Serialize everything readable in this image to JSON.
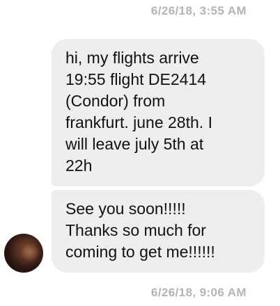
{
  "conversation": {
    "timestamp_top": "6/26/18, 3:55 AM",
    "messages": [
      {
        "text": "hi, my flights arrive\n19:55 flight DE2414\n(Condor) from\nfrankfurt. june 28th. I\nwill leave july 5th at\n22h"
      },
      {
        "text": "See you soon!!!!!\nThanks so much for\ncoming to get me!!!!!!"
      }
    ],
    "timestamp_bottom": "6/26/18, 9:06 AM"
  },
  "colors": {
    "bubble_background": "#eeeef0",
    "timestamp_text": "#b3b3b8",
    "message_text": "#111111"
  },
  "icons": {
    "avatar": "contact-avatar-photo"
  }
}
